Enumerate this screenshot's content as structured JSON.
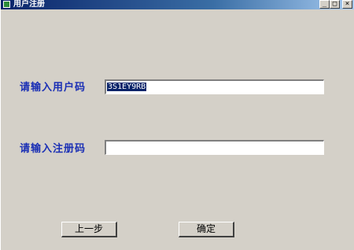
{
  "window": {
    "title": "用户注册",
    "controls": {
      "minimize": "_",
      "maximize": "□",
      "close": "×"
    }
  },
  "form": {
    "user_code": {
      "label": "请输入用户码",
      "value": "3S1EY9RB"
    },
    "reg_code": {
      "label": "请输入注册码",
      "value": ""
    }
  },
  "buttons": {
    "prev_label": "上一步",
    "ok_label": "确定"
  },
  "colors": {
    "label_blue": "#1a2fb5",
    "titlebar_start": "#0a246a",
    "face": "#d4d0c8"
  }
}
